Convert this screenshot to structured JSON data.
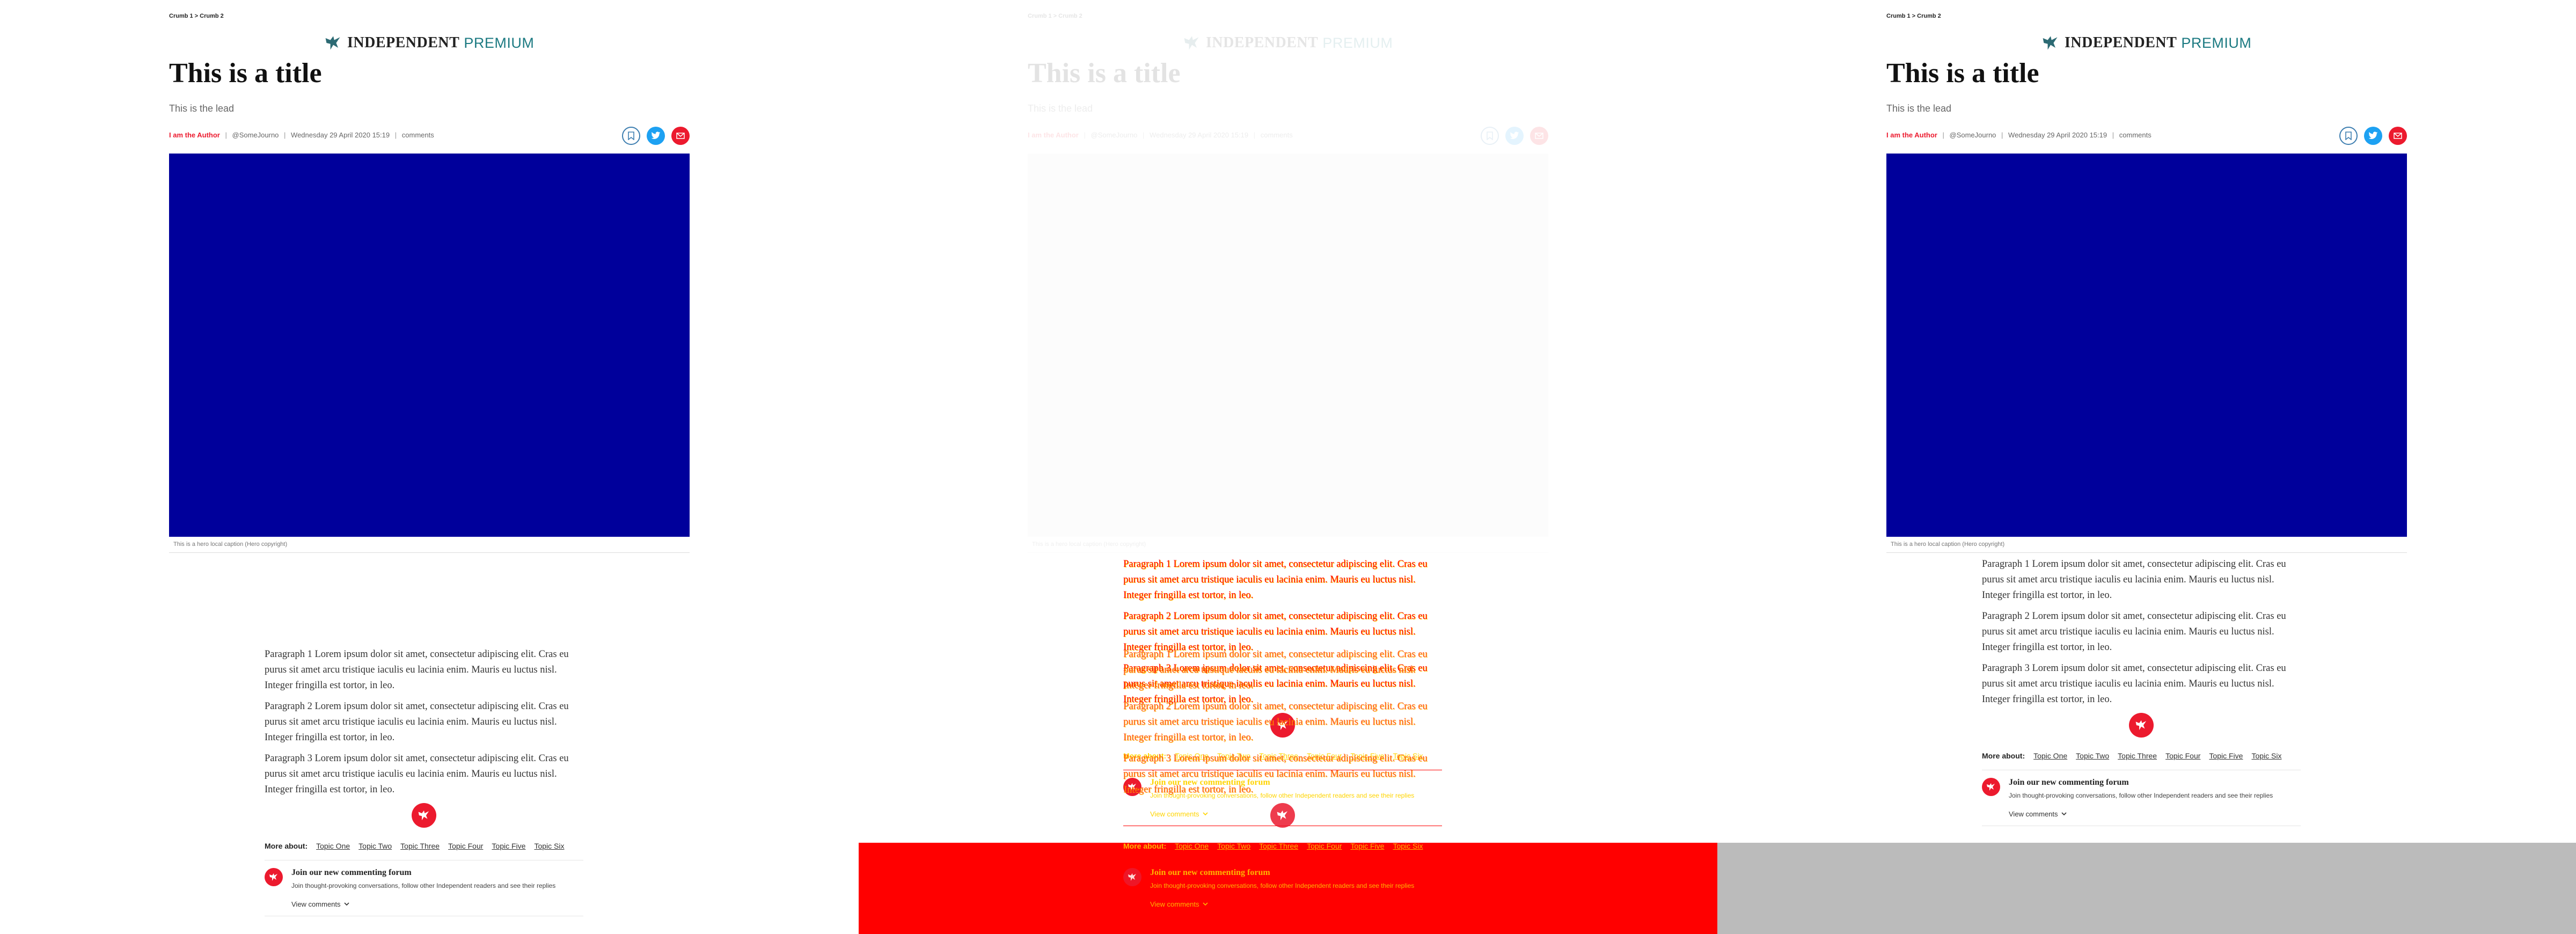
{
  "breadcrumb": "Crumb 1 > Crumb 2",
  "brand": {
    "name": "INDEPENDENT",
    "suffix": "PREMIUM"
  },
  "title": "This is a title",
  "lead": "This is the lead",
  "meta": {
    "author": "I am the Author",
    "handle": "@SomeJourno",
    "date": "Wednesday 29 April 2020 15:19",
    "comments": "comments"
  },
  "caption": "This is a hero local caption (Hero copyright)",
  "paragraphs": [
    "Paragraph 1 Lorem ipsum dolor sit amet, consectetur adipiscing elit. Cras eu purus sit amet arcu tristique iaculis eu lacinia enim. Mauris eu luctus nisl. Integer fringilla est tortor, in leo.",
    "Paragraph 2 Lorem ipsum dolor sit amet, consectetur adipiscing elit. Cras eu purus sit amet arcu tristique iaculis eu lacinia enim. Mauris eu luctus nisl. Integer fringilla est tortor, in leo.",
    "Paragraph 3 Lorem ipsum dolor sit amet, consectetur adipiscing elit. Cras eu purus sit amet arcu tristique iaculis eu lacinia enim. Mauris eu luctus nisl. Integer fringilla est tortor, in leo."
  ],
  "more_about": {
    "label": "More about:",
    "topics": [
      "Topic One",
      "Topic Two",
      "Topic Three",
      "Topic Four",
      "Topic Five",
      "Topic Six"
    ]
  },
  "forum": {
    "title": "Join our new commenting forum",
    "description": "Join thought-provoking conversations, follow other Independent readers and see their replies",
    "view_comments": "View comments"
  },
  "colors": {
    "accent_red": "#ec1a2e",
    "premium_teal": "#1c7a82",
    "hero_blue": "#00009b",
    "twitter_blue": "#1da1f2",
    "diff_red": "#ff0000",
    "diff_yellow": "#ffd400",
    "right_bottom_grey": "#bbbbbb"
  },
  "icons": [
    "eagle-logo-icon",
    "bookmark-icon",
    "twitter-icon",
    "email-icon",
    "chevron-down-icon"
  ]
}
